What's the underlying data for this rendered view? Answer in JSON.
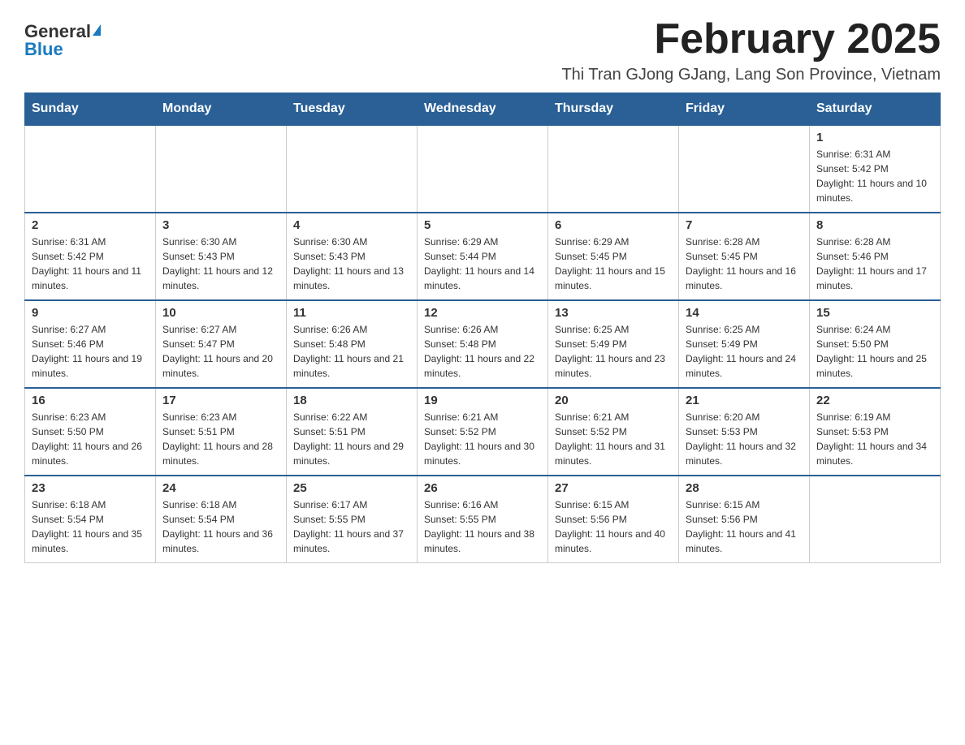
{
  "logo": {
    "general": "General",
    "blue": "Blue"
  },
  "header": {
    "title": "February 2025",
    "location": "Thi Tran GJong GJang, Lang Son Province, Vietnam"
  },
  "weekdays": [
    "Sunday",
    "Monday",
    "Tuesday",
    "Wednesday",
    "Thursday",
    "Friday",
    "Saturday"
  ],
  "weeks": [
    [
      {
        "day": "",
        "info": ""
      },
      {
        "day": "",
        "info": ""
      },
      {
        "day": "",
        "info": ""
      },
      {
        "day": "",
        "info": ""
      },
      {
        "day": "",
        "info": ""
      },
      {
        "day": "",
        "info": ""
      },
      {
        "day": "1",
        "info": "Sunrise: 6:31 AM\nSunset: 5:42 PM\nDaylight: 11 hours and 10 minutes."
      }
    ],
    [
      {
        "day": "2",
        "info": "Sunrise: 6:31 AM\nSunset: 5:42 PM\nDaylight: 11 hours and 11 minutes."
      },
      {
        "day": "3",
        "info": "Sunrise: 6:30 AM\nSunset: 5:43 PM\nDaylight: 11 hours and 12 minutes."
      },
      {
        "day": "4",
        "info": "Sunrise: 6:30 AM\nSunset: 5:43 PM\nDaylight: 11 hours and 13 minutes."
      },
      {
        "day": "5",
        "info": "Sunrise: 6:29 AM\nSunset: 5:44 PM\nDaylight: 11 hours and 14 minutes."
      },
      {
        "day": "6",
        "info": "Sunrise: 6:29 AM\nSunset: 5:45 PM\nDaylight: 11 hours and 15 minutes."
      },
      {
        "day": "7",
        "info": "Sunrise: 6:28 AM\nSunset: 5:45 PM\nDaylight: 11 hours and 16 minutes."
      },
      {
        "day": "8",
        "info": "Sunrise: 6:28 AM\nSunset: 5:46 PM\nDaylight: 11 hours and 17 minutes."
      }
    ],
    [
      {
        "day": "9",
        "info": "Sunrise: 6:27 AM\nSunset: 5:46 PM\nDaylight: 11 hours and 19 minutes."
      },
      {
        "day": "10",
        "info": "Sunrise: 6:27 AM\nSunset: 5:47 PM\nDaylight: 11 hours and 20 minutes."
      },
      {
        "day": "11",
        "info": "Sunrise: 6:26 AM\nSunset: 5:48 PM\nDaylight: 11 hours and 21 minutes."
      },
      {
        "day": "12",
        "info": "Sunrise: 6:26 AM\nSunset: 5:48 PM\nDaylight: 11 hours and 22 minutes."
      },
      {
        "day": "13",
        "info": "Sunrise: 6:25 AM\nSunset: 5:49 PM\nDaylight: 11 hours and 23 minutes."
      },
      {
        "day": "14",
        "info": "Sunrise: 6:25 AM\nSunset: 5:49 PM\nDaylight: 11 hours and 24 minutes."
      },
      {
        "day": "15",
        "info": "Sunrise: 6:24 AM\nSunset: 5:50 PM\nDaylight: 11 hours and 25 minutes."
      }
    ],
    [
      {
        "day": "16",
        "info": "Sunrise: 6:23 AM\nSunset: 5:50 PM\nDaylight: 11 hours and 26 minutes."
      },
      {
        "day": "17",
        "info": "Sunrise: 6:23 AM\nSunset: 5:51 PM\nDaylight: 11 hours and 28 minutes."
      },
      {
        "day": "18",
        "info": "Sunrise: 6:22 AM\nSunset: 5:51 PM\nDaylight: 11 hours and 29 minutes."
      },
      {
        "day": "19",
        "info": "Sunrise: 6:21 AM\nSunset: 5:52 PM\nDaylight: 11 hours and 30 minutes."
      },
      {
        "day": "20",
        "info": "Sunrise: 6:21 AM\nSunset: 5:52 PM\nDaylight: 11 hours and 31 minutes."
      },
      {
        "day": "21",
        "info": "Sunrise: 6:20 AM\nSunset: 5:53 PM\nDaylight: 11 hours and 32 minutes."
      },
      {
        "day": "22",
        "info": "Sunrise: 6:19 AM\nSunset: 5:53 PM\nDaylight: 11 hours and 34 minutes."
      }
    ],
    [
      {
        "day": "23",
        "info": "Sunrise: 6:18 AM\nSunset: 5:54 PM\nDaylight: 11 hours and 35 minutes."
      },
      {
        "day": "24",
        "info": "Sunrise: 6:18 AM\nSunset: 5:54 PM\nDaylight: 11 hours and 36 minutes."
      },
      {
        "day": "25",
        "info": "Sunrise: 6:17 AM\nSunset: 5:55 PM\nDaylight: 11 hours and 37 minutes."
      },
      {
        "day": "26",
        "info": "Sunrise: 6:16 AM\nSunset: 5:55 PM\nDaylight: 11 hours and 38 minutes."
      },
      {
        "day": "27",
        "info": "Sunrise: 6:15 AM\nSunset: 5:56 PM\nDaylight: 11 hours and 40 minutes."
      },
      {
        "day": "28",
        "info": "Sunrise: 6:15 AM\nSunset: 5:56 PM\nDaylight: 11 hours and 41 minutes."
      },
      {
        "day": "",
        "info": ""
      }
    ]
  ]
}
